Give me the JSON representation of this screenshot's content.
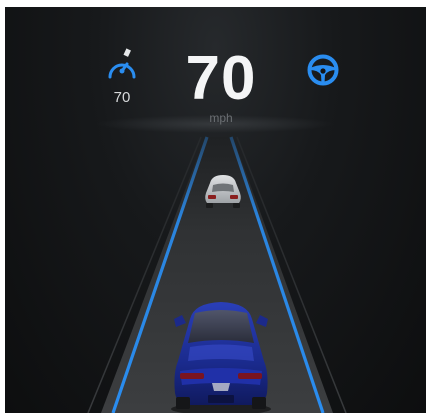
{
  "cluster": {
    "speed_limit": "70",
    "speed_value": "70",
    "speed_unit": "mph"
  },
  "icons": {
    "speed_limit_icon": "speedometer-icon",
    "autosteer_icon": "steering-wheel-icon"
  },
  "colors": {
    "accent_blue": "#2a8df0",
    "ego_car": "#1a2d9a",
    "lead_car": "#c9cbcd",
    "road": "#3a3c3e",
    "background": "#121314"
  }
}
